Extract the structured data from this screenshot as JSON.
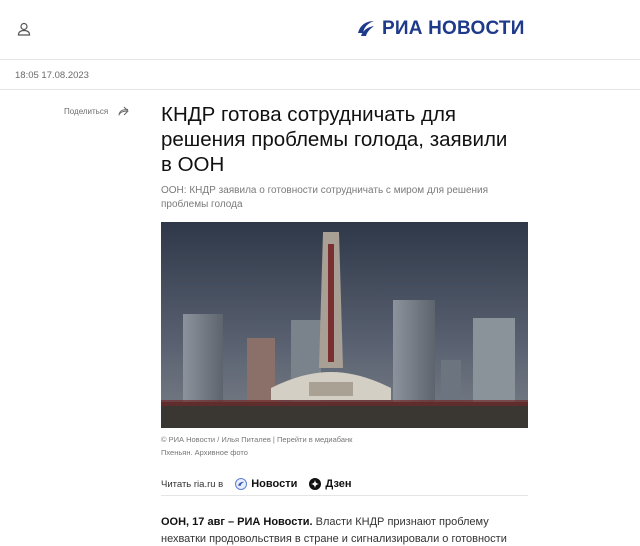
{
  "header": {
    "logo_text": "РИА НОВОСТИ",
    "brand_color": "#1e3a8a"
  },
  "meta": {
    "date": "18:05 17.08.2023"
  },
  "share": {
    "label": "Поделиться"
  },
  "article": {
    "title": "КНДР готова сотрудничать для решения проблемы голода, заявили в ООН",
    "subtitle": "ООН: КНДР заявила о готовности сотрудничать с миром для решения проблемы голода",
    "photo_credit": "© РИА Новости / Илья Питалев",
    "photo_link": "Перейти в медиабанк",
    "photo_caption": "Пхеньян. Архивное фото",
    "lead_bold": "ООН, 17 авг – РИА Новости.",
    "lead_text": " Власти КНДР признают проблему нехватки продовольствия в стране и сигнализировали о готовности"
  },
  "read_bar": {
    "label": "Читать ria.ru в",
    "links": [
      "Новости",
      "Дзен"
    ]
  }
}
